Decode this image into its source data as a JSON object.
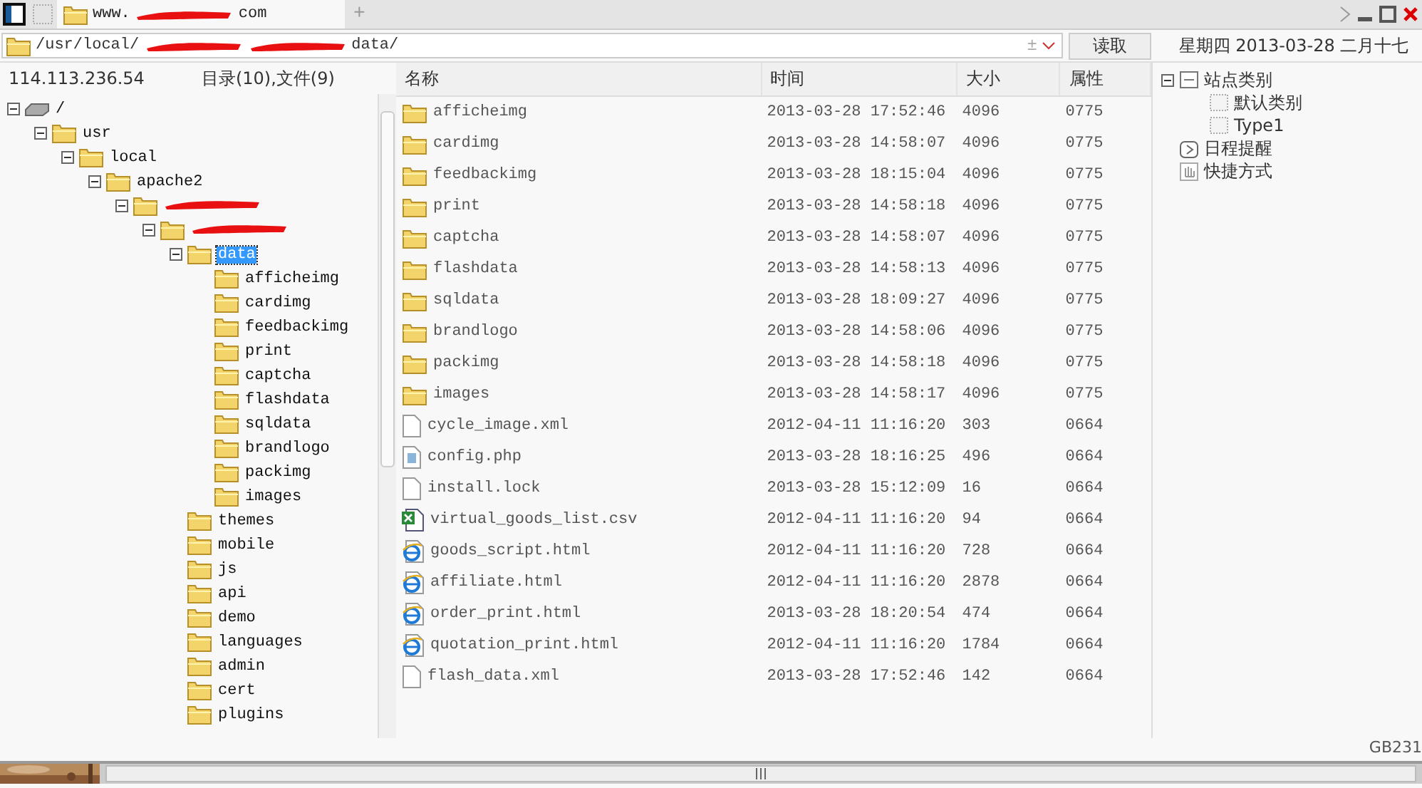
{
  "tab_bar": {
    "tabs": [
      {
        "title_start": "www.",
        "title_end": "com",
        "selected": true
      }
    ],
    "new_tab": "+"
  },
  "address_bar": {
    "path_start": "/usr/local/",
    "path_end": "data/",
    "toggle": "±",
    "button": "读取"
  },
  "date_bar": {
    "text": "星期四 2013-03-28 二月十七"
  },
  "left_header": {
    "host": "114.113.236.54",
    "summary": "目录(10),文件(9)"
  },
  "tree": [
    {
      "label": "/",
      "kind": "drive",
      "expanded": true,
      "selected": false,
      "children": [
        {
          "label": "usr",
          "kind": "folder",
          "expanded": true,
          "selected": false,
          "children": [
            {
              "label": "local",
              "kind": "folder",
              "expanded": true,
              "selected": false,
              "children": [
                {
                  "label": "apache2",
                  "kind": "folder",
                  "expanded": true,
                  "selected": false,
                  "children": [
                    {
                      "redacted": true,
                      "kind": "folder",
                      "expanded": true,
                      "children": [
                        {
                          "redacted": true,
                          "kind": "folder",
                          "expanded": true,
                          "children": [
                            {
                              "label": "data",
                              "kind": "folder",
                              "expanded": true,
                              "selected": true,
                              "children": [
                                {
                                  "label": "afficheimg",
                                  "kind": "folder",
                                  "expanded": false,
                                  "selected": false
                                },
                                {
                                  "label": "cardimg",
                                  "kind": "folder",
                                  "expanded": false,
                                  "selected": false
                                },
                                {
                                  "label": "feedbackimg",
                                  "kind": "folder",
                                  "expanded": false,
                                  "selected": false
                                },
                                {
                                  "label": "print",
                                  "kind": "folder",
                                  "expanded": false,
                                  "selected": false
                                },
                                {
                                  "label": "captcha",
                                  "kind": "folder",
                                  "expanded": false,
                                  "selected": false
                                },
                                {
                                  "label": "flashdata",
                                  "kind": "folder",
                                  "expanded": false,
                                  "selected": false
                                },
                                {
                                  "label": "sqldata",
                                  "kind": "folder",
                                  "expanded": false,
                                  "selected": false
                                },
                                {
                                  "label": "brandlogo",
                                  "kind": "folder",
                                  "expanded": false,
                                  "selected": false
                                },
                                {
                                  "label": "packimg",
                                  "kind": "folder",
                                  "expanded": false,
                                  "selected": false
                                },
                                {
                                  "label": "images",
                                  "kind": "folder",
                                  "expanded": false,
                                  "selected": false
                                }
                              ]
                            },
                            {
                              "label": "themes",
                              "kind": "folder",
                              "expanded": false,
                              "selected": false
                            },
                            {
                              "label": "mobile",
                              "kind": "folder",
                              "expanded": false,
                              "selected": false
                            },
                            {
                              "label": "js",
                              "kind": "folder",
                              "expanded": false,
                              "selected": false
                            },
                            {
                              "label": "api",
                              "kind": "folder",
                              "expanded": false,
                              "selected": false
                            },
                            {
                              "label": "demo",
                              "kind": "folder",
                              "expanded": false,
                              "selected": false
                            },
                            {
                              "label": "languages",
                              "kind": "folder",
                              "expanded": false,
                              "selected": false
                            },
                            {
                              "label": "admin",
                              "kind": "folder",
                              "expanded": false,
                              "selected": false
                            },
                            {
                              "label": "cert",
                              "kind": "folder",
                              "expanded": false,
                              "selected": false
                            },
                            {
                              "label": "plugins",
                              "kind": "folder",
                              "expanded": false,
                              "selected": false
                            }
                          ]
                        }
                      ]
                    }
                  ]
                }
              ]
            }
          ]
        }
      ]
    }
  ],
  "file_table": {
    "columns": [
      "名称",
      "时间",
      "大小",
      "属性"
    ],
    "rows": [
      {
        "kind": "folder",
        "name": "afficheimg",
        "time": "2013-03-28 17:52:46",
        "size": "4096",
        "mode": "0775"
      },
      {
        "kind": "folder",
        "name": "cardimg",
        "time": "2013-03-28 14:58:07",
        "size": "4096",
        "mode": "0775"
      },
      {
        "kind": "folder",
        "name": "feedbackimg",
        "time": "2013-03-28 18:15:04",
        "size": "4096",
        "mode": "0775"
      },
      {
        "kind": "folder",
        "name": "print",
        "time": "2013-03-28 14:58:18",
        "size": "4096",
        "mode": "0775"
      },
      {
        "kind": "folder",
        "name": "captcha",
        "time": "2013-03-28 14:58:07",
        "size": "4096",
        "mode": "0775"
      },
      {
        "kind": "folder",
        "name": "flashdata",
        "time": "2013-03-28 14:58:13",
        "size": "4096",
        "mode": "0775"
      },
      {
        "kind": "folder",
        "name": "sqldata",
        "time": "2013-03-28 18:09:27",
        "size": "4096",
        "mode": "0775"
      },
      {
        "kind": "folder",
        "name": "brandlogo",
        "time": "2013-03-28 14:58:06",
        "size": "4096",
        "mode": "0775"
      },
      {
        "kind": "folder",
        "name": "packimg",
        "time": "2013-03-28 14:58:18",
        "size": "4096",
        "mode": "0775"
      },
      {
        "kind": "folder",
        "name": "images",
        "time": "2013-03-28 14:58:17",
        "size": "4096",
        "mode": "0775"
      },
      {
        "kind": "file",
        "name": "cycle_image.xml",
        "time": "2012-04-11 11:16:20",
        "size": "303",
        "mode": "0664"
      },
      {
        "kind": "script",
        "name": "config.php",
        "time": "2013-03-28 18:16:25",
        "size": "496",
        "mode": "0664"
      },
      {
        "kind": "file",
        "name": "install.lock",
        "time": "2013-03-28 15:12:09",
        "size": "16",
        "mode": "0664"
      },
      {
        "kind": "sheet",
        "name": "virtual_goods_list.csv",
        "time": "2012-04-11 11:16:20",
        "size": "94",
        "mode": "0664"
      },
      {
        "kind": "web",
        "name": "goods_script.html",
        "time": "2012-04-11 11:16:20",
        "size": "728",
        "mode": "0664"
      },
      {
        "kind": "web",
        "name": "affiliate.html",
        "time": "2012-04-11 11:16:20",
        "size": "2878",
        "mode": "0664"
      },
      {
        "kind": "web",
        "name": "order_print.html",
        "time": "2013-03-28 18:20:54",
        "size": "474",
        "mode": "0664"
      },
      {
        "kind": "web",
        "name": "quotation_print.html",
        "time": "2012-04-11 11:16:20",
        "size": "1784",
        "mode": "0664"
      },
      {
        "kind": "file",
        "name": "flash_data.xml",
        "time": "2013-03-28 17:52:46",
        "size": "142",
        "mode": "0664"
      }
    ]
  },
  "side_tree": [
    {
      "label": "站点类别",
      "kind": "category",
      "expanded": true,
      "children": [
        {
          "label": "默认类别",
          "kind": "dotted"
        },
        {
          "label": "Type1",
          "kind": "dotted"
        }
      ]
    },
    {
      "label": "日程提醒",
      "kind": "schedule",
      "expanded": false
    },
    {
      "label": "快捷方式",
      "kind": "hand",
      "expanded": false
    }
  ],
  "status_bar": {
    "encoding": "GB231"
  }
}
